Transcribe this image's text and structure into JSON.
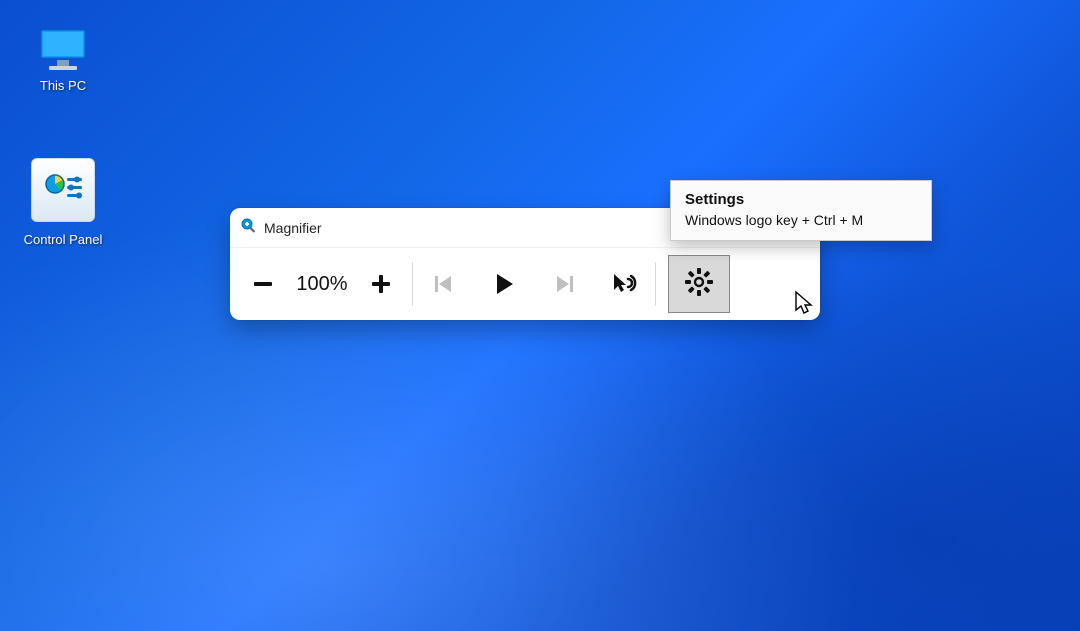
{
  "desktop": {
    "icons": [
      {
        "label": "This PC"
      },
      {
        "label": "Control Panel"
      }
    ]
  },
  "magnifier": {
    "title": "Magnifier",
    "zoom_level": "100%"
  },
  "tooltip": {
    "title": "Settings",
    "body": "Windows logo key + Ctrl + M"
  }
}
